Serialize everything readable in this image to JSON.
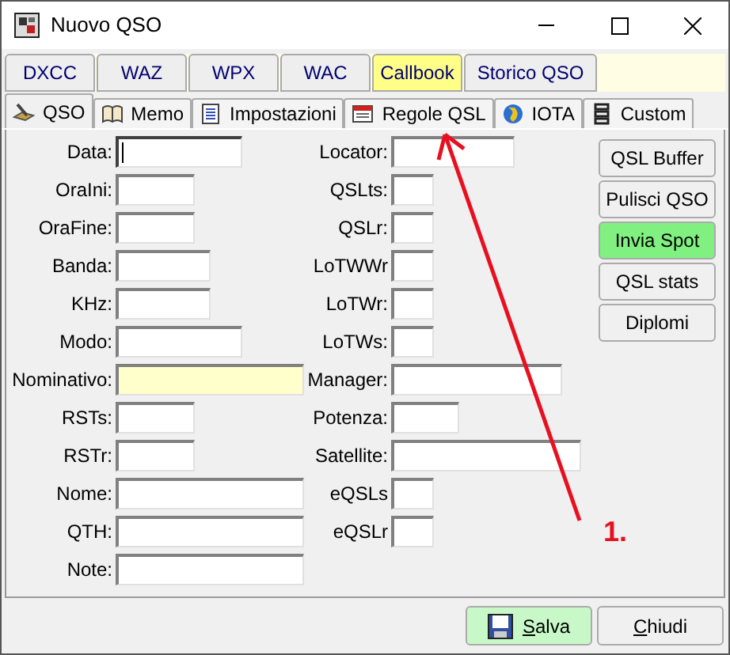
{
  "window": {
    "title": "Nuovo QSO"
  },
  "top_buttons": [
    {
      "label": "DXCC",
      "highlighted": false
    },
    {
      "label": "WAZ",
      "highlighted": false
    },
    {
      "label": "WPX",
      "highlighted": false
    },
    {
      "label": "WAC",
      "highlighted": false
    },
    {
      "label": "Callbook",
      "highlighted": true
    },
    {
      "label": "Storico QSO",
      "highlighted": false
    }
  ],
  "tabs": [
    {
      "label": "QSO",
      "kind": "pencil",
      "selected": true
    },
    {
      "label": "Memo",
      "kind": "book",
      "selected": false
    },
    {
      "label": "Impostazioni",
      "kind": "document",
      "selected": false
    },
    {
      "label": "Regole QSL",
      "kind": "calendar",
      "selected": false
    },
    {
      "label": "IOTA",
      "kind": "globe",
      "selected": false
    },
    {
      "label": "Custom",
      "kind": "stack",
      "selected": false
    }
  ],
  "left_fields": [
    {
      "label": "Data:",
      "focused": true,
      "highlighted": false
    },
    {
      "label": "OraIni:",
      "focused": false,
      "highlighted": false
    },
    {
      "label": "OraFine:",
      "focused": false,
      "highlighted": false
    },
    {
      "label": "Banda:",
      "focused": false,
      "highlighted": false
    },
    {
      "label": "KHz:",
      "focused": false,
      "highlighted": false
    },
    {
      "label": "Modo:",
      "focused": false,
      "highlighted": false
    },
    {
      "label": "Nominativo:",
      "focused": false,
      "highlighted": true
    },
    {
      "label": "RSTs:",
      "focused": false,
      "highlighted": false
    },
    {
      "label": "RSTr:",
      "focused": false,
      "highlighted": false
    },
    {
      "label": "Nome:",
      "focused": false,
      "highlighted": false
    },
    {
      "label": "QTH:",
      "focused": false,
      "highlighted": false
    },
    {
      "label": "Note:",
      "focused": false,
      "highlighted": false
    }
  ],
  "right_fields": [
    {
      "label": "Locator:"
    },
    {
      "label": "QSLts:"
    },
    {
      "label": "QSLr:"
    },
    {
      "label": "LoTWWr"
    },
    {
      "label": "LoTWr:"
    },
    {
      "label": "LoTWs:"
    },
    {
      "label": "Manager:"
    },
    {
      "label": "Potenza:"
    },
    {
      "label": "Satellite:"
    },
    {
      "label": "eQSLs"
    },
    {
      "label": "eQSLr"
    }
  ],
  "side_buttons": [
    {
      "label": "QSL Buffer",
      "highlighted": false
    },
    {
      "label": "Pulisci QSO",
      "highlighted": false
    },
    {
      "label": "Invia Spot",
      "highlighted": true
    },
    {
      "label": "QSL stats",
      "highlighted": false
    },
    {
      "label": "Diplomi",
      "highlighted": false
    }
  ],
  "annotation": {
    "label": "1."
  },
  "footer_buttons": [
    {
      "label": "Salva",
      "kind": "save",
      "highlighted": true
    },
    {
      "label": "Chiudi",
      "kind": "plain",
      "highlighted": false
    }
  ]
}
